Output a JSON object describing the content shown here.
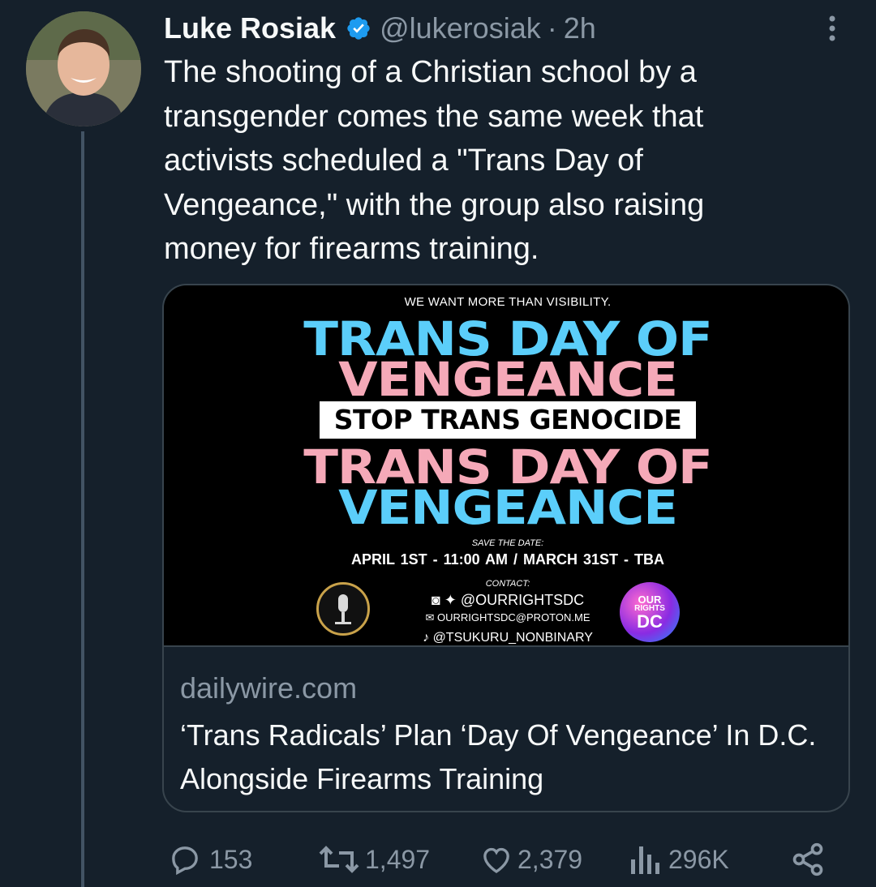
{
  "tweet": {
    "author_name": "Luke Rosiak",
    "handle": "@lukerosiak",
    "separator": "·",
    "time": "2h",
    "text": "The shooting of a Christian school by a\ntransgender comes the same week that\nactivists scheduled a \"Trans Day of\nVengeance,\" with the group also raising\nmoney for firearms training."
  },
  "card": {
    "domain": "dailywire.com",
    "title": "‘Trans Radicals’ Plan ‘Day Of Vengeance’ In D.C. Alongside Firearms Training",
    "poster": {
      "tagline": "WE WANT MORE THAN VISIBILITY.",
      "line1": "TRANS DAY OF",
      "line2": "VENGEANCE",
      "banner": "STOP TRANS GENOCIDE",
      "line3": "TRANS DAY OF",
      "line4": "VENGEANCE",
      "save_the_date": "SAVE THE DATE:",
      "dates": "APRIL 1ST - 11:00 AM  /  MARCH 31ST - TBA",
      "contact_label": "CONTACT:",
      "contact_social": "@OURRIGHTSDC",
      "contact_email": "OURRIGHTSDC@PROTON.ME",
      "contact_other": "@TSUKURU_NONBINARY",
      "logo_right_line1": "OUR",
      "logo_right_line2": "RIGHTS",
      "logo_right_line3": "DC",
      "colors": {
        "blue": "#5bcefa",
        "pink": "#f5a9b8"
      }
    }
  },
  "actions": {
    "replies": "153",
    "retweets": "1,497",
    "likes": "2,379",
    "views": "296K"
  },
  "icons": [
    "verified-badge-icon",
    "more-options-icon",
    "reply-icon",
    "retweet-icon",
    "like-icon",
    "views-icon",
    "share-icon"
  ],
  "colors": {
    "background": "#15202b",
    "text": "#f7f9f9",
    "muted": "#8b98a5",
    "border": "#38444d",
    "verified": "#1d9bf0"
  }
}
